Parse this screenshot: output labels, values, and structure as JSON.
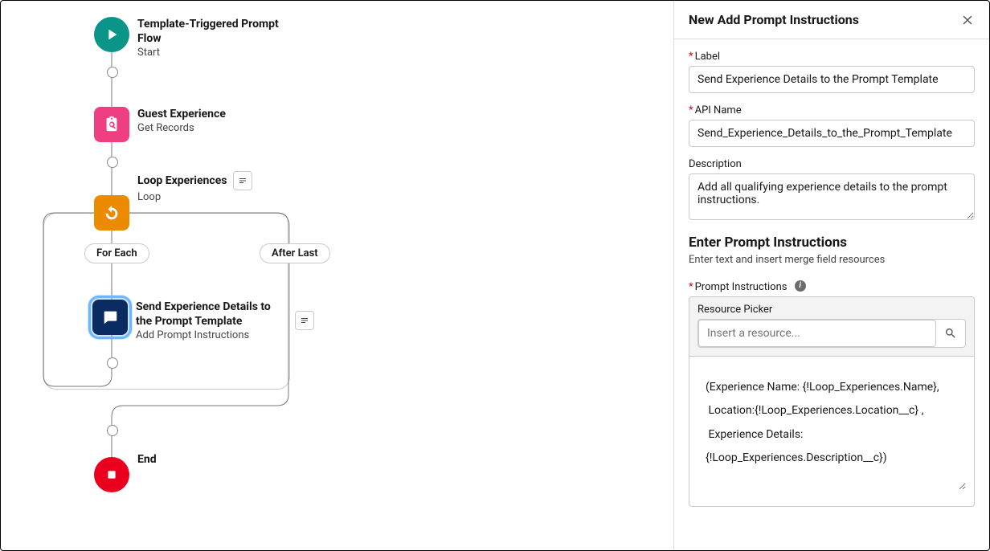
{
  "canvas": {
    "start": {
      "title": "Template-Triggered Prompt Flow",
      "sub": "Start"
    },
    "records": {
      "title": "Guest Experience",
      "sub": "Get Records"
    },
    "loop": {
      "title": "Loop Experiences",
      "sub": "Loop",
      "for_each": "For Each",
      "after_last": "After Last"
    },
    "addPrompt": {
      "title": "Send Experience Details to the Prompt Template",
      "sub": "Add Prompt Instructions"
    },
    "end": {
      "title": "End"
    }
  },
  "panel": {
    "heading": "New Add Prompt Instructions",
    "label_label": "Label",
    "label_value": "Send Experience Details to the Prompt Template",
    "api_label": "API Name",
    "api_value": "Send_Experience_Details_to_the_Prompt_Template",
    "desc_label": "Description",
    "desc_value": "Add all qualifying experience details to the prompt instructions.",
    "section_title": "Enter Prompt Instructions",
    "section_sub": "Enter text and insert merge field resources",
    "pi_label": "Prompt Instructions",
    "picker_label": "Resource Picker",
    "picker_placeholder": "Insert a resource...",
    "prompt_text": "(Experience Name: {!Loop_Experiences.Name},\n Location:{!Loop_Experiences.Location__c} ,\n Experience Details: {!Loop_Experiences.Description__c})"
  }
}
